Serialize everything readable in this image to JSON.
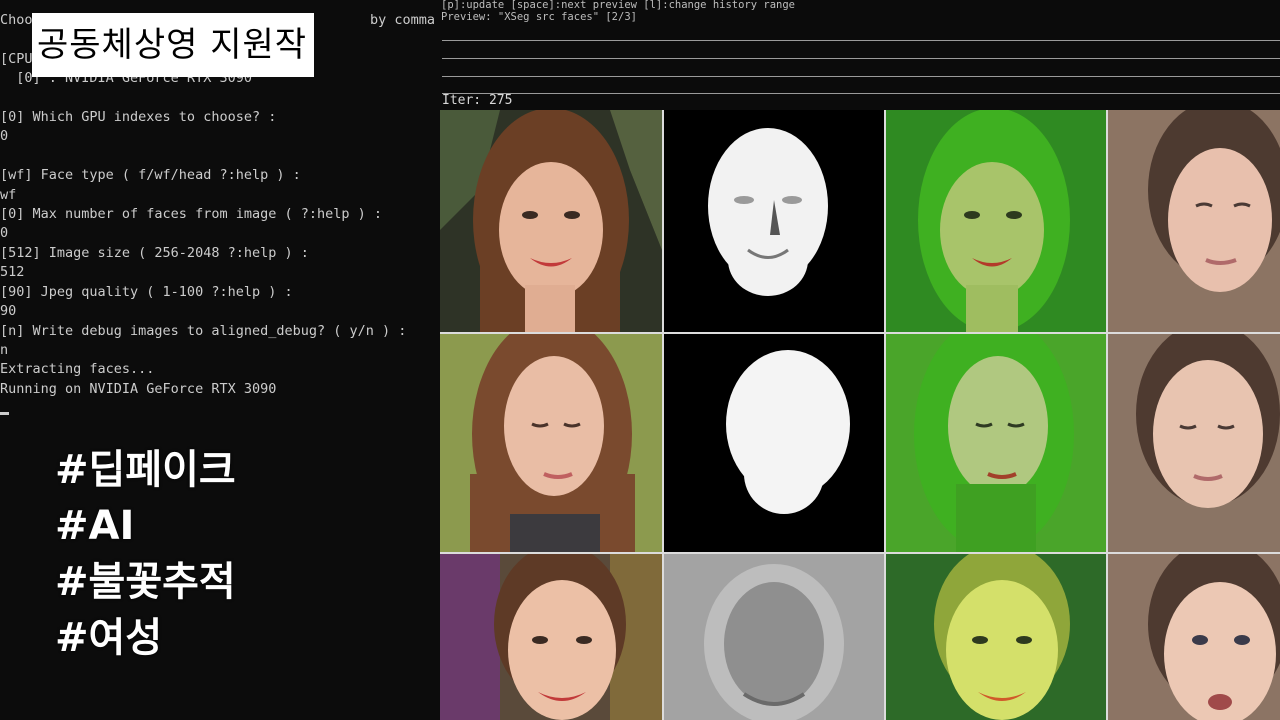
{
  "console": {
    "lines": [
      "Choo",
      "",
      "[CPU",
      "  [0] : NVIDIA GeForce RTX 3090",
      "",
      "[0] Which GPU indexes to choose? :",
      "0",
      "",
      "[wf] Face type ( f/wf/head ?:help ) :",
      "wf",
      "[0] Max number of faces from image ( ?:help ) :",
      "0",
      "[512] Image size ( 256-2048 ?:help ) :",
      "512",
      "[90] Jpeg quality ( 1-100 ?:help ) :",
      "90",
      "[n] Write debug images to aligned_debug? ( y/n ) :",
      "n",
      "Extracting faces...",
      "Running on NVIDIA GeForce RTX 3090"
    ],
    "top_right_fragment": "by comma"
  },
  "overlay": {
    "caption": "공동체상영 지원작",
    "hashtags": [
      "#딥페이크",
      "#AI",
      "#불꽃추적",
      "#여성"
    ]
  },
  "preview": {
    "help_line": "[p]:update [space]:next preview [l]:change history range",
    "preview_title": "Preview: \"XSeg src faces\" [2/3]",
    "iter": "Iter: 275"
  },
  "colors": {
    "mask_overlay": "#3fc21f",
    "hair_brown": "#6b3f25",
    "skin": "#e6b59a",
    "lips": "#c23a3a"
  }
}
